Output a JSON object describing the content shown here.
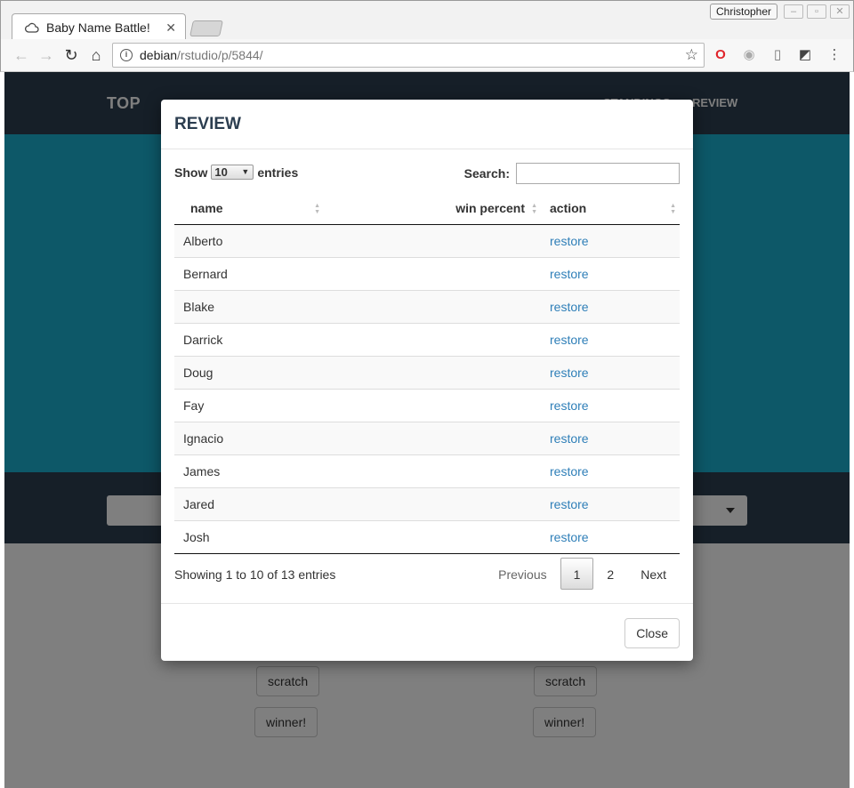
{
  "browser": {
    "tab_title": "Baby Name Battle!",
    "tab_close": "✕",
    "profile_name": "Christopher",
    "url_host": "debian",
    "url_path": "/rstudio/p/5844/"
  },
  "app": {
    "brand": "TOP",
    "nav_links": [
      "STANDINGS",
      "REVIEW"
    ],
    "buttons": {
      "scratch": "scratch",
      "winner": "winner!"
    }
  },
  "modal": {
    "title": "REVIEW",
    "length": {
      "show": "Show",
      "value": "10",
      "entries": "entries"
    },
    "search_label": "Search:",
    "columns": [
      "name",
      "win percent",
      "action"
    ],
    "rows": [
      {
        "name": "Alberto",
        "win_percent": "",
        "action": "restore"
      },
      {
        "name": "Bernard",
        "win_percent": "",
        "action": "restore"
      },
      {
        "name": "Blake",
        "win_percent": "",
        "action": "restore"
      },
      {
        "name": "Darrick",
        "win_percent": "",
        "action": "restore"
      },
      {
        "name": "Doug",
        "win_percent": "",
        "action": "restore"
      },
      {
        "name": "Fay",
        "win_percent": "",
        "action": "restore"
      },
      {
        "name": "Ignacio",
        "win_percent": "",
        "action": "restore"
      },
      {
        "name": "James",
        "win_percent": "",
        "action": "restore"
      },
      {
        "name": "Jared",
        "win_percent": "",
        "action": "restore"
      },
      {
        "name": "Josh",
        "win_percent": "",
        "action": "restore"
      }
    ],
    "info": "Showing 1 to 10 of 13 entries",
    "pagination": {
      "previous": "Previous",
      "pages": [
        "1",
        "2"
      ],
      "current": "1",
      "next": "Next"
    },
    "close_label": "Close"
  },
  "colors": {
    "navbar": "#2c3e50",
    "hero": "#1ab0d0",
    "link": "#2f7fb8"
  }
}
